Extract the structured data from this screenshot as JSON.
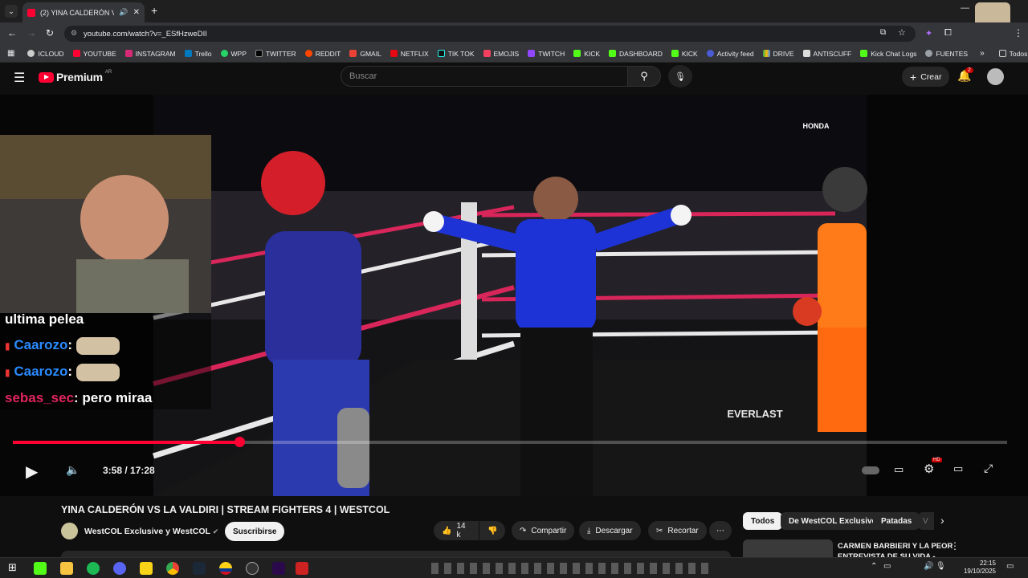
{
  "browser": {
    "tab_title": "(2) YINA CALDERÓN VS LA V",
    "url": "youtube.com/watch?v=_ESfHzweDII",
    "bookmarks": [
      "ICLOUD",
      "YOUTUBE",
      "INSTAGRAM",
      "Trello",
      "WPP",
      "TWITTER",
      "REDDIT",
      "GMAIL",
      "NETFLIX",
      "TIK TOK",
      "EMOJIS",
      "TWITCH",
      "KICK",
      "DASHBOARD",
      "KICK",
      "Activity feed",
      "DRIVE",
      "ANTISCUFF",
      "Kick Chat Logs",
      "FUENTES"
    ],
    "all_bookmarks": "Todos los favoritos",
    "profile_badge": "x5"
  },
  "youtube": {
    "logo": "Premium",
    "country": "AR",
    "search_placeholder": "Buscar",
    "create_label": "Crear",
    "notif_count": "2"
  },
  "overlay": {
    "chat": [
      {
        "user": "ultima pelea",
        "msg": ""
      },
      {
        "user": "Caarozo",
        "msg": ""
      },
      {
        "user": "Caarozo",
        "msg": ""
      },
      {
        "user": "sebas_sec",
        "msg": "pero miraa"
      }
    ],
    "brand1": "HONDA",
    "brand2": "EVERLAST"
  },
  "player": {
    "time": "3:58 / 17:28",
    "progress": 0.228,
    "hd_badge": "HD"
  },
  "video": {
    "title": "YINA CALDERÓN VS LA VALDIRI | STREAM FIGHTERS 4 | WESTCOL",
    "channel": "WestCOL Exclusive y WestCOL",
    "subscribe": "Suscribirse",
    "likes": "14 k",
    "share": "Compartir",
    "download": "Descargar",
    "clip": "Recortar"
  },
  "chips": [
    "Todos",
    "De WestCOL Exclusive",
    "Patadas",
    "V"
  ],
  "suggestion": {
    "title": "CARMEN BARBIERI Y LA PEOR",
    "subtitle": "ENTREVISTA DE SU VIDA -"
  },
  "taskbar": {
    "time": "22:15",
    "date": "19/10/2025"
  },
  "colors": {
    "progress": "#ff0033",
    "youtube_red": "#ff0033",
    "ref_shirt": "#1e33d6",
    "left_fighter": "#2a2f9c",
    "right_fighter": "#ff7a18"
  }
}
